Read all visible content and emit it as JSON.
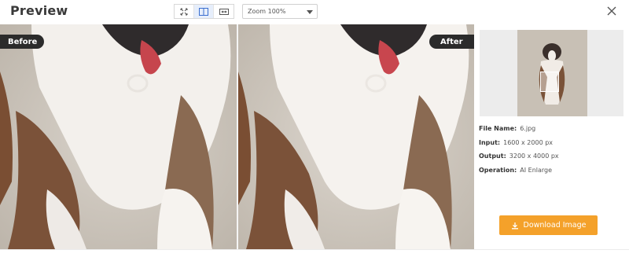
{
  "header": {
    "title": "Preview",
    "view_modes": [
      {
        "icon": "fit-screen-icon",
        "active": false
      },
      {
        "icon": "split-view-icon",
        "active": true
      },
      {
        "icon": "compare-slider-icon",
        "active": false
      }
    ],
    "zoom_label": "Zoom 100%"
  },
  "compare": {
    "before_label": "Before",
    "after_label": "After"
  },
  "details": {
    "file_name_label": "File Name:",
    "file_name": "6.jpg",
    "input_label": "Input:",
    "input_value": "1600 x 2000 px",
    "output_label": "Output:",
    "output_value": "3200 x 4000 px",
    "operation_label": "Operation:",
    "operation_value": "AI Enlarge"
  },
  "actions": {
    "download_label": "Download Image"
  },
  "colors": {
    "accent": "#f4a12a",
    "tag_bg": "#2b2b2b",
    "active_view": "#e6eefb"
  }
}
